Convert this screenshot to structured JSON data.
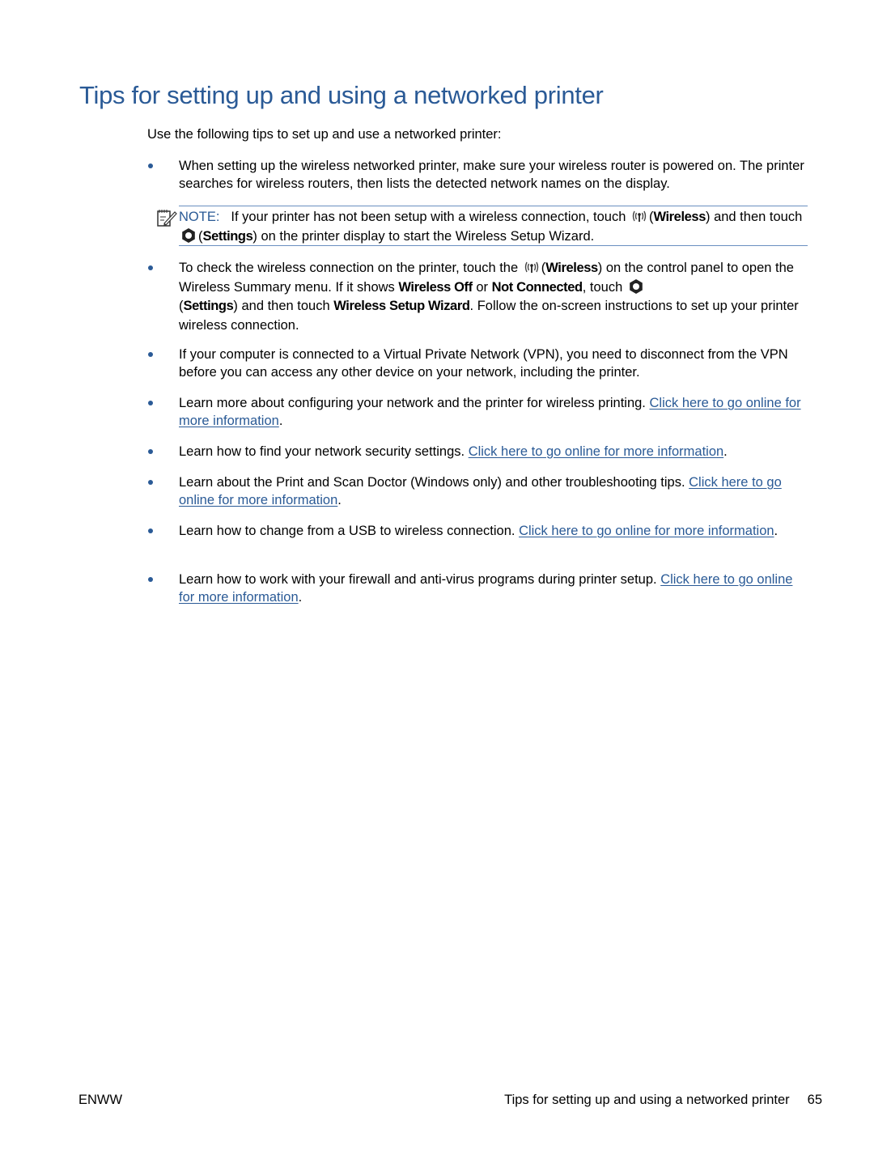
{
  "title": "Tips for setting up and using a networked printer",
  "intro": "Use the following tips to set up and use a networked printer:",
  "colors": {
    "accent": "#2a5a96",
    "rule": "#6a8fc0",
    "text": "#000000"
  },
  "icons": {
    "note": "note-pencil-icon",
    "wireless": "wireless-icon",
    "settings": "settings-gear-icon",
    "bullet": "bullet-dot-icon"
  },
  "bullets": [
    {
      "text": "When setting up the wireless networked printer, make sure your wireless router is powered on. The printer searches for wireless routers, then lists the detected network names on the display."
    },
    {
      "t1": "To check the wireless connection on the printer, touch the ",
      "wireless_label": "Wireless",
      "t2": " on the control panel to open the Wireless Summary menu. If it shows ",
      "wireless_off": "Wireless Off",
      "t3": " or ",
      "not_connected": "Not Connected",
      "t4": ", touch ",
      "settings_label": "Settings",
      "t5": " and then touch ",
      "wizard": "Wireless Setup Wizard",
      "t6": ". Follow the on-screen instructions to set up your printer wireless connection."
    },
    {
      "text": "If your computer is connected to a Virtual Private Network (VPN), you need to disconnect from the VPN before you can access any other device on your network, including the printer."
    },
    {
      "text": "Learn more about configuring your network and the printer for wireless printing. ",
      "link": "Click here to go online for more information"
    },
    {
      "text": "Learn how to find your network security settings. ",
      "link": "Click here to go online for more information"
    },
    {
      "text": "Learn about the Print and Scan Doctor (Windows only) and other troubleshooting tips. ",
      "link": "Click here to go online for more information"
    },
    {
      "text": "Learn how to change from a USB to wireless connection. ",
      "link": "Click here to go online for more information"
    },
    {
      "text": "Learn how to work with your firewall and anti-virus programs during printer setup. ",
      "link": "Click here to go online for more information"
    }
  ],
  "note": {
    "label": "NOTE:",
    "t1": "If your printer has not been setup with a wireless connection, touch ",
    "wireless_label": "Wireless",
    "t2": " and then touch ",
    "settings_label": "Settings",
    "t3": " on the printer display to start the Wireless Setup Wizard."
  },
  "footer": {
    "left": "ENWW",
    "right": "Tips for setting up and using a networked printer",
    "page_number": "65"
  }
}
